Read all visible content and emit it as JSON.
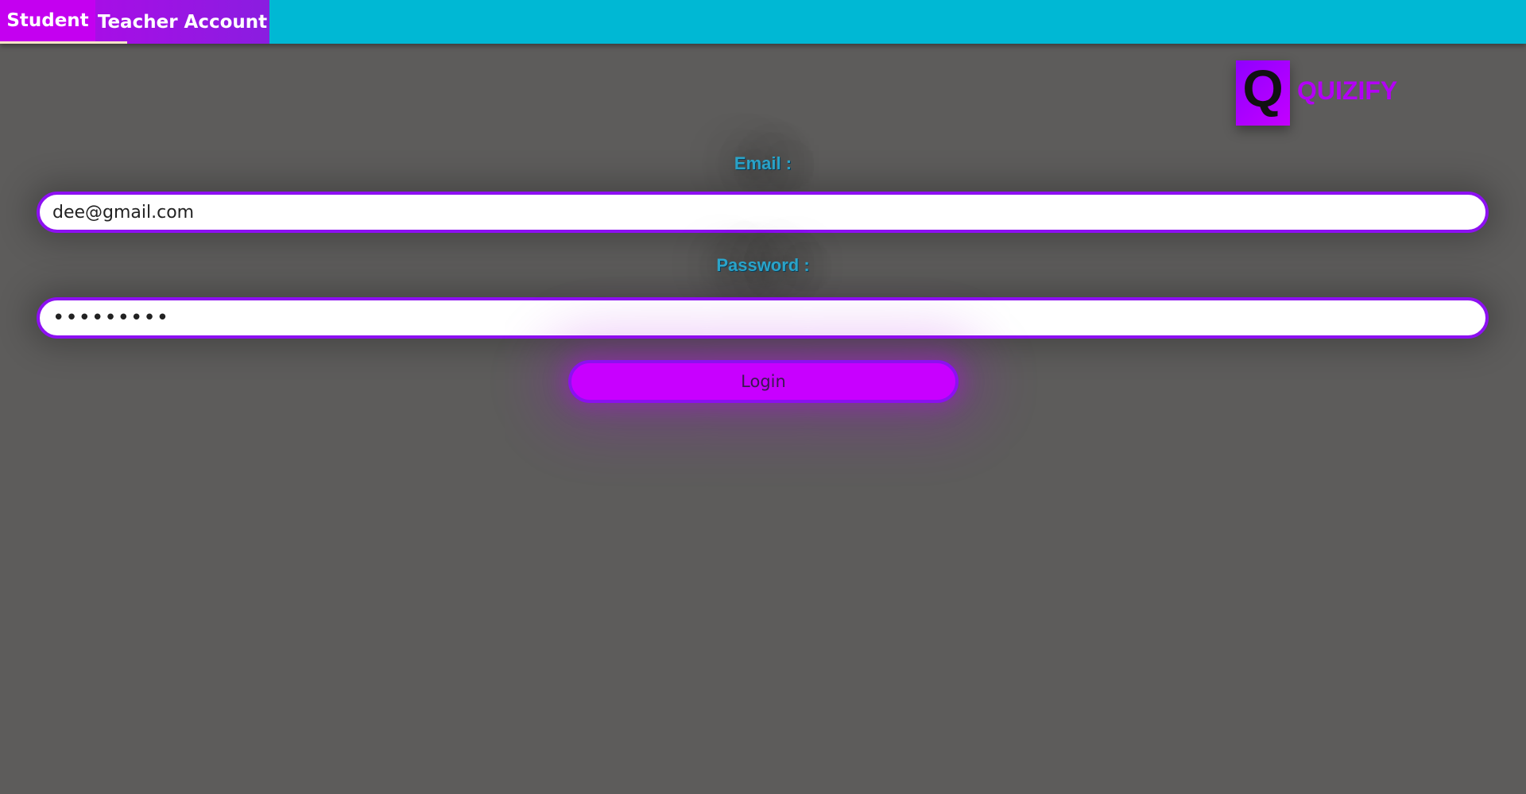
{
  "tabs": {
    "student_label": "Student",
    "teacher_label": "Teacher Account"
  },
  "logo": {
    "letter": "Q",
    "name": "QUIZIFY"
  },
  "form": {
    "email_label": "Email :",
    "email_value": "dee@gmail.com",
    "password_label": "Password :",
    "password_value": "123456789",
    "login_label": "Login"
  },
  "colors": {
    "topbar": "#00b8d4",
    "active_tab": "#c400f0",
    "accent_purple": "#8d10f2",
    "button_magenta": "#c800ff",
    "label_blue": "#2ba6cc",
    "background": "#5d5c5b"
  },
  "icons": {
    "logo": "quizify-logo-icon"
  }
}
